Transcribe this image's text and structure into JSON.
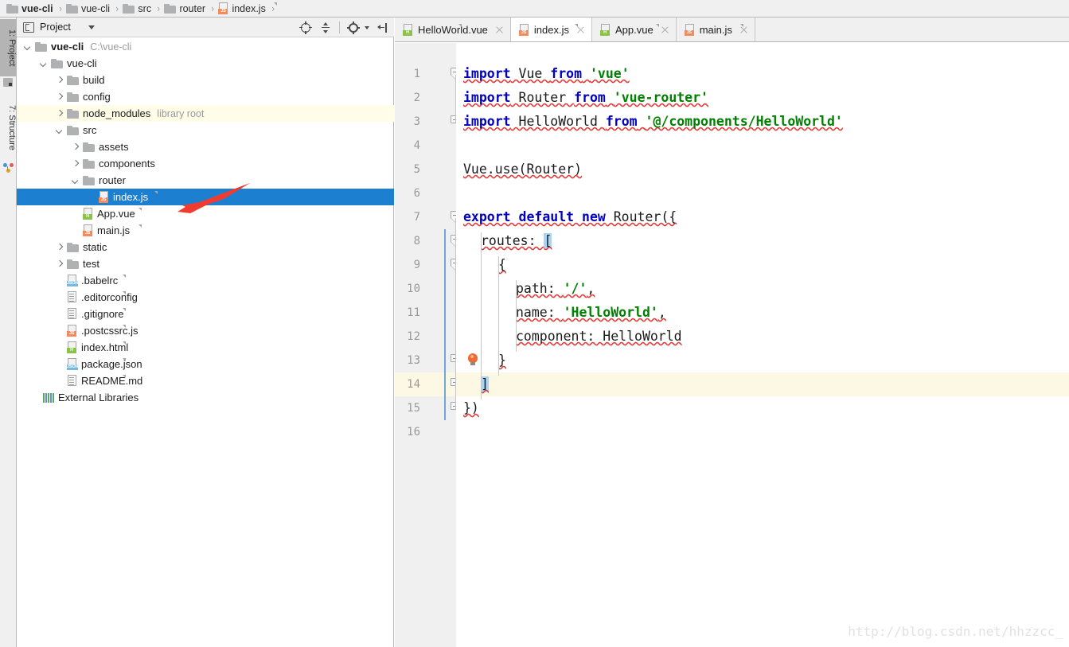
{
  "breadcrumb": {
    "items": [
      {
        "label": "vue-cli",
        "icon": "folder-icon",
        "bold": true
      },
      {
        "label": "vue-cli",
        "icon": "folder-icon",
        "bold": false
      },
      {
        "label": "src",
        "icon": "folder-icon",
        "bold": false
      },
      {
        "label": "router",
        "icon": "folder-icon",
        "bold": false
      },
      {
        "label": "index.js",
        "icon": "js-file-icon",
        "bold": false
      }
    ],
    "separator": "›"
  },
  "tool_windows": [
    {
      "label": "1: Project",
      "icon": "project-icon",
      "active": true
    },
    {
      "label": "7: Structure",
      "icon": "structure-icon",
      "active": false
    }
  ],
  "project_panel": {
    "title": "Project",
    "title_icon": "project-view-icon",
    "dropdown_icon": "chevron-down-icon",
    "tools": [
      {
        "name": "scroll-from-source-icon",
        "label": "Scroll from Source"
      },
      {
        "name": "collapse-all-icon",
        "label": "Collapse All"
      },
      {
        "name": "settings-gear-icon",
        "label": "Settings"
      },
      {
        "name": "hide-panel-icon",
        "label": "Hide"
      }
    ],
    "tree": [
      {
        "label": "vue-cli",
        "note": "C:\\vue-cli",
        "indent": 0,
        "arrow": "down",
        "icon": "folder-icon",
        "bold": true,
        "state": "normal"
      },
      {
        "label": "vue-cli",
        "note": "",
        "indent": 1,
        "arrow": "down",
        "icon": "folder-icon",
        "bold": false,
        "state": "normal"
      },
      {
        "label": "build",
        "note": "",
        "indent": 2,
        "arrow": "right",
        "icon": "folder-icon",
        "bold": false,
        "state": "normal"
      },
      {
        "label": "config",
        "note": "",
        "indent": 2,
        "arrow": "right",
        "icon": "folder-icon",
        "bold": false,
        "state": "normal"
      },
      {
        "label": "node_modules",
        "note": "library root",
        "indent": 2,
        "arrow": "right",
        "icon": "folder-icon",
        "bold": false,
        "state": "library"
      },
      {
        "label": "src",
        "note": "",
        "indent": 2,
        "arrow": "down",
        "icon": "folder-icon",
        "bold": false,
        "state": "normal"
      },
      {
        "label": "assets",
        "note": "",
        "indent": 3,
        "arrow": "right",
        "icon": "folder-icon",
        "bold": false,
        "state": "normal"
      },
      {
        "label": "components",
        "note": "",
        "indent": 3,
        "arrow": "right",
        "icon": "folder-icon",
        "bold": false,
        "state": "normal"
      },
      {
        "label": "router",
        "note": "",
        "indent": 3,
        "arrow": "down",
        "icon": "folder-icon",
        "bold": false,
        "state": "normal"
      },
      {
        "label": "index.js",
        "note": "",
        "indent": 4,
        "arrow": "none",
        "icon": "js-file-icon",
        "bold": false,
        "state": "selected"
      },
      {
        "label": "App.vue",
        "note": "",
        "indent": 3,
        "arrow": "none",
        "icon": "vue-file-icon",
        "bold": false,
        "state": "normal"
      },
      {
        "label": "main.js",
        "note": "",
        "indent": 3,
        "arrow": "none",
        "icon": "js-file-icon",
        "bold": false,
        "state": "normal"
      },
      {
        "label": "static",
        "note": "",
        "indent": 2,
        "arrow": "right",
        "icon": "folder-icon",
        "bold": false,
        "state": "normal"
      },
      {
        "label": "test",
        "note": "",
        "indent": 2,
        "arrow": "right",
        "icon": "folder-icon",
        "bold": false,
        "state": "normal"
      },
      {
        "label": ".babelrc",
        "note": "",
        "indent": 2,
        "arrow": "none",
        "icon": "json-file-icon",
        "bold": false,
        "state": "normal"
      },
      {
        "label": ".editorconfig",
        "note": "",
        "indent": 2,
        "arrow": "none",
        "icon": "text-file-icon",
        "bold": false,
        "state": "normal"
      },
      {
        "label": ".gitignore",
        "note": "",
        "indent": 2,
        "arrow": "none",
        "icon": "text-file-icon",
        "bold": false,
        "state": "normal"
      },
      {
        "label": ".postcssrc.js",
        "note": "",
        "indent": 2,
        "arrow": "none",
        "icon": "js-file-icon",
        "bold": false,
        "state": "normal"
      },
      {
        "label": "index.html",
        "note": "",
        "indent": 2,
        "arrow": "none",
        "icon": "html-file-icon",
        "bold": false,
        "state": "normal"
      },
      {
        "label": "package.json",
        "note": "",
        "indent": 2,
        "arrow": "none",
        "icon": "json-file-icon",
        "bold": false,
        "state": "normal"
      },
      {
        "label": "README.md",
        "note": "",
        "indent": 2,
        "arrow": "none",
        "icon": "text-file-icon",
        "bold": false,
        "state": "normal"
      },
      {
        "label": "External Libraries",
        "note": "",
        "indent": 0.5,
        "arrow": "none",
        "icon": "external-libraries-icon",
        "bold": false,
        "state": "normal"
      }
    ]
  },
  "editor": {
    "tabs": [
      {
        "label": "HelloWorld.vue",
        "icon": "vue-file-icon",
        "active": false,
        "close_icon": "close-icon"
      },
      {
        "label": "index.js",
        "icon": "js-file-icon",
        "active": true,
        "close_icon": "close-icon"
      },
      {
        "label": "App.vue",
        "icon": "vue-file-icon",
        "active": false,
        "close_icon": "close-icon"
      },
      {
        "label": "main.js",
        "icon": "js-file-icon",
        "active": false,
        "close_icon": "close-icon"
      }
    ],
    "current_line": 14,
    "line_numbers": [
      1,
      2,
      3,
      4,
      5,
      6,
      7,
      8,
      9,
      10,
      11,
      12,
      13,
      14,
      15,
      16
    ],
    "lines": [
      {
        "n": 1,
        "indent": 0,
        "tokens": [
          {
            "t": "import",
            "c": "kw"
          },
          {
            "t": " Vue ",
            "c": "pln"
          },
          {
            "t": "from",
            "c": "kw"
          },
          {
            "t": " ",
            "c": "pln"
          },
          {
            "t": "'vue'",
            "c": "str"
          }
        ],
        "squiggly": true
      },
      {
        "n": 2,
        "indent": 0,
        "tokens": [
          {
            "t": "import",
            "c": "kw"
          },
          {
            "t": " Router ",
            "c": "pln"
          },
          {
            "t": "from",
            "c": "kw"
          },
          {
            "t": " ",
            "c": "pln"
          },
          {
            "t": "'vue-router'",
            "c": "str"
          }
        ],
        "squiggly": true
      },
      {
        "n": 3,
        "indent": 0,
        "tokens": [
          {
            "t": "import",
            "c": "kw"
          },
          {
            "t": " HelloWorld ",
            "c": "pln"
          },
          {
            "t": "from",
            "c": "kw"
          },
          {
            "t": " ",
            "c": "pln"
          },
          {
            "t": "'@/components/HelloWorld'",
            "c": "str"
          }
        ],
        "squiggly": true
      },
      {
        "n": 4,
        "indent": 0,
        "tokens": [],
        "squiggly": false
      },
      {
        "n": 5,
        "indent": 0,
        "tokens": [
          {
            "t": "Vue.use(Router)",
            "c": "pln"
          }
        ],
        "squiggly": true
      },
      {
        "n": 6,
        "indent": 0,
        "tokens": [],
        "squiggly": false
      },
      {
        "n": 7,
        "indent": 0,
        "tokens": [
          {
            "t": "export default new",
            "c": "kw"
          },
          {
            "t": " Router({",
            "c": "pln"
          }
        ],
        "squiggly": true
      },
      {
        "n": 8,
        "indent": 1,
        "tokens": [
          {
            "t": "routes: ",
            "c": "pln"
          },
          {
            "t": "[",
            "c": "brkhl"
          }
        ],
        "squiggly": true
      },
      {
        "n": 9,
        "indent": 2,
        "tokens": [
          {
            "t": "{",
            "c": "pln"
          }
        ],
        "squiggly": true
      },
      {
        "n": 10,
        "indent": 3,
        "tokens": [
          {
            "t": "path: ",
            "c": "pln"
          },
          {
            "t": "'/'",
            "c": "str"
          },
          {
            "t": ",",
            "c": "pln"
          }
        ],
        "squiggly": true
      },
      {
        "n": 11,
        "indent": 3,
        "tokens": [
          {
            "t": "name: ",
            "c": "pln"
          },
          {
            "t": "'HelloWorld'",
            "c": "str"
          },
          {
            "t": ",",
            "c": "pln"
          }
        ],
        "squiggly": true
      },
      {
        "n": 12,
        "indent": 3,
        "tokens": [
          {
            "t": "component: HelloWorld",
            "c": "pln"
          }
        ],
        "squiggly": true
      },
      {
        "n": 13,
        "indent": 2,
        "tokens": [
          {
            "t": "}",
            "c": "pln"
          }
        ],
        "squiggly": true
      },
      {
        "n": 14,
        "indent": 1,
        "tokens": [
          {
            "t": "]",
            "c": "brkhl"
          }
        ],
        "squiggly": true
      },
      {
        "n": 15,
        "indent": 0,
        "tokens": [
          {
            "t": "})",
            "c": "pln"
          }
        ],
        "squiggly": true
      },
      {
        "n": 16,
        "indent": 0,
        "tokens": [],
        "squiggly": false
      }
    ],
    "intention_bulb": {
      "line": 13,
      "icon": "intention-bulb-icon"
    }
  },
  "annotation": {
    "arrow": {
      "name": "red-pointer-arrow",
      "color": "#f23b2f"
    }
  },
  "watermark": "http://blog.csdn.net/hhzzcc_",
  "colors": {
    "selection_blue": "#1d7fd0",
    "current_line_yellow": "#fdf8e3",
    "library_row_yellow": "#fffce8",
    "keyword": "#0000c0",
    "string": "#008000",
    "error_squiggle": "#e04040",
    "bracket_highlight": "#a8d4f5"
  }
}
